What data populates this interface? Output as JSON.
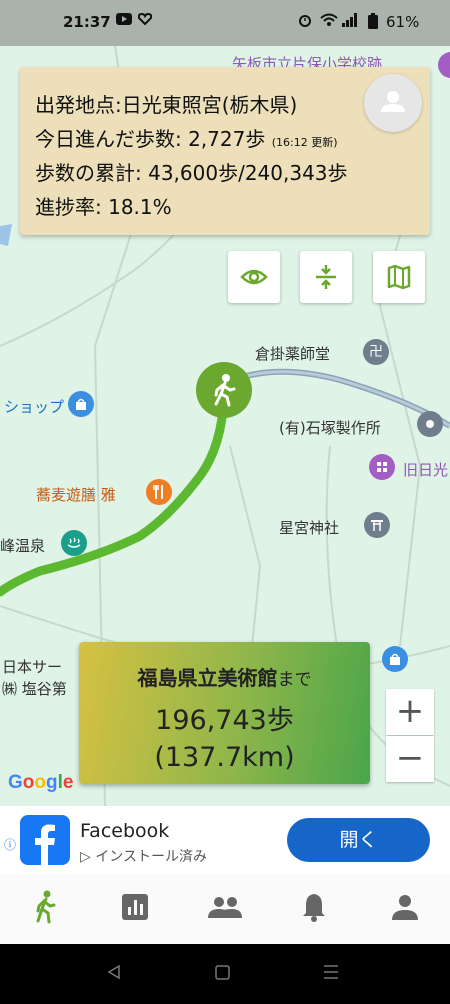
{
  "status_bar": {
    "time": "21:37",
    "battery": "61%"
  },
  "info_panel": {
    "start_label": "出発地点:日光東照宮(栃木県)",
    "today_steps_label": "今日進んだ歩数: 2,727歩",
    "today_updated": "(16:12 更新)",
    "total_steps_label": "歩数の累計: 43,600歩/240,343歩",
    "progress_label": "進捗率: 18.1%"
  },
  "map": {
    "pois": {
      "top_cut": "矢板市立片保小学校跡",
      "yakushido": "倉掛薬師堂",
      "shop": "ショップ",
      "ishizuka": "(有)石塚製作所",
      "old_nikko": "旧日光",
      "soba": "蕎麦遊膳 雅",
      "hoshimiya": "星宮神社",
      "onsen": "峰温泉",
      "nihon_sa": "日本サー",
      "shiotani": "㈱ 塩谷第",
      "kurakake": "倉掛"
    },
    "route_color": "#5cb82e",
    "walker_color": "#6aa82f",
    "google_logo": "Google"
  },
  "destination": {
    "name": "福島県立美術館",
    "suffix": "まで",
    "steps": "196,743歩",
    "distance": "(137.7km)"
  },
  "zoom": {
    "plus": "+",
    "minus": "−"
  },
  "ad": {
    "title": "Facebook",
    "subtitle": "インストール済み",
    "button": "開く",
    "info_icon": "i"
  },
  "nav": {
    "items": [
      "walk-icon",
      "chart-icon",
      "group-icon",
      "bell-icon",
      "person-icon"
    ],
    "active_color": "#6aa82f"
  }
}
